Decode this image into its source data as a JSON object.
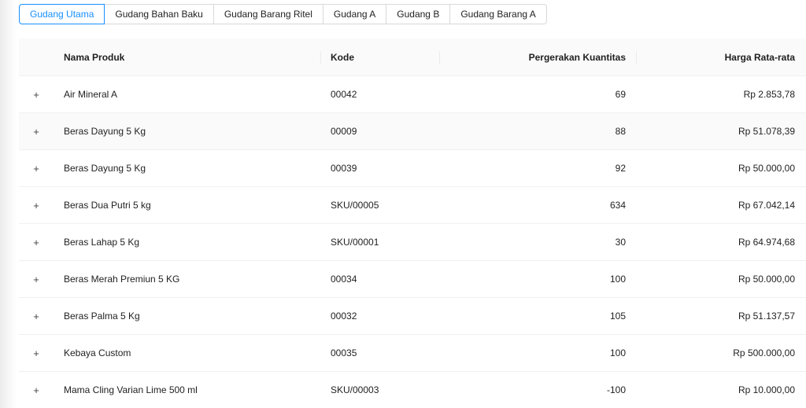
{
  "tabs": [
    {
      "label": "Gudang Utama",
      "active": true
    },
    {
      "label": "Gudang Bahan Baku",
      "active": false
    },
    {
      "label": "Gudang Barang Ritel",
      "active": false
    },
    {
      "label": "Gudang A",
      "active": false
    },
    {
      "label": "Gudang B",
      "active": false
    },
    {
      "label": "Gudang Barang A",
      "active": false
    }
  ],
  "table": {
    "headers": {
      "name": "Nama Produk",
      "code": "Kode",
      "qty": "Pergerakan Kuantitas",
      "price": "Harga Rata-rata"
    },
    "expand_symbol": "+",
    "rows": [
      {
        "name": "Air Mineral A",
        "code": "00042",
        "qty": "69",
        "price": "Rp 2.853,78"
      },
      {
        "name": "Beras Dayung 5 Kg",
        "code": "00009",
        "qty": "88",
        "price": "Rp 51.078,39"
      },
      {
        "name": "Beras Dayung 5 Kg",
        "code": "00039",
        "qty": "92",
        "price": "Rp 50.000,00"
      },
      {
        "name": "Beras Dua Putri 5 kg",
        "code": "SKU/00005",
        "qty": "634",
        "price": "Rp 67.042,14"
      },
      {
        "name": "Beras Lahap 5 Kg",
        "code": "SKU/00001",
        "qty": "30",
        "price": "Rp 64.974,68"
      },
      {
        "name": "Beras Merah Premiun 5 KG",
        "code": "00034",
        "qty": "100",
        "price": "Rp 50.000,00"
      },
      {
        "name": "Beras Palma 5 Kg",
        "code": "00032",
        "qty": "105",
        "price": "Rp 51.137,57"
      },
      {
        "name": "Kebaya Custom",
        "code": "00035",
        "qty": "100",
        "price": "Rp 500.000,00"
      },
      {
        "name": "Mama Cling Varian Lime 500 ml",
        "code": "SKU/00003",
        "qty": "-100",
        "price": "Rp 10.000,00"
      }
    ]
  },
  "colors": {
    "accent": "#1890ff",
    "header_bg": "#fafafa",
    "border": "#f0f0f0"
  }
}
